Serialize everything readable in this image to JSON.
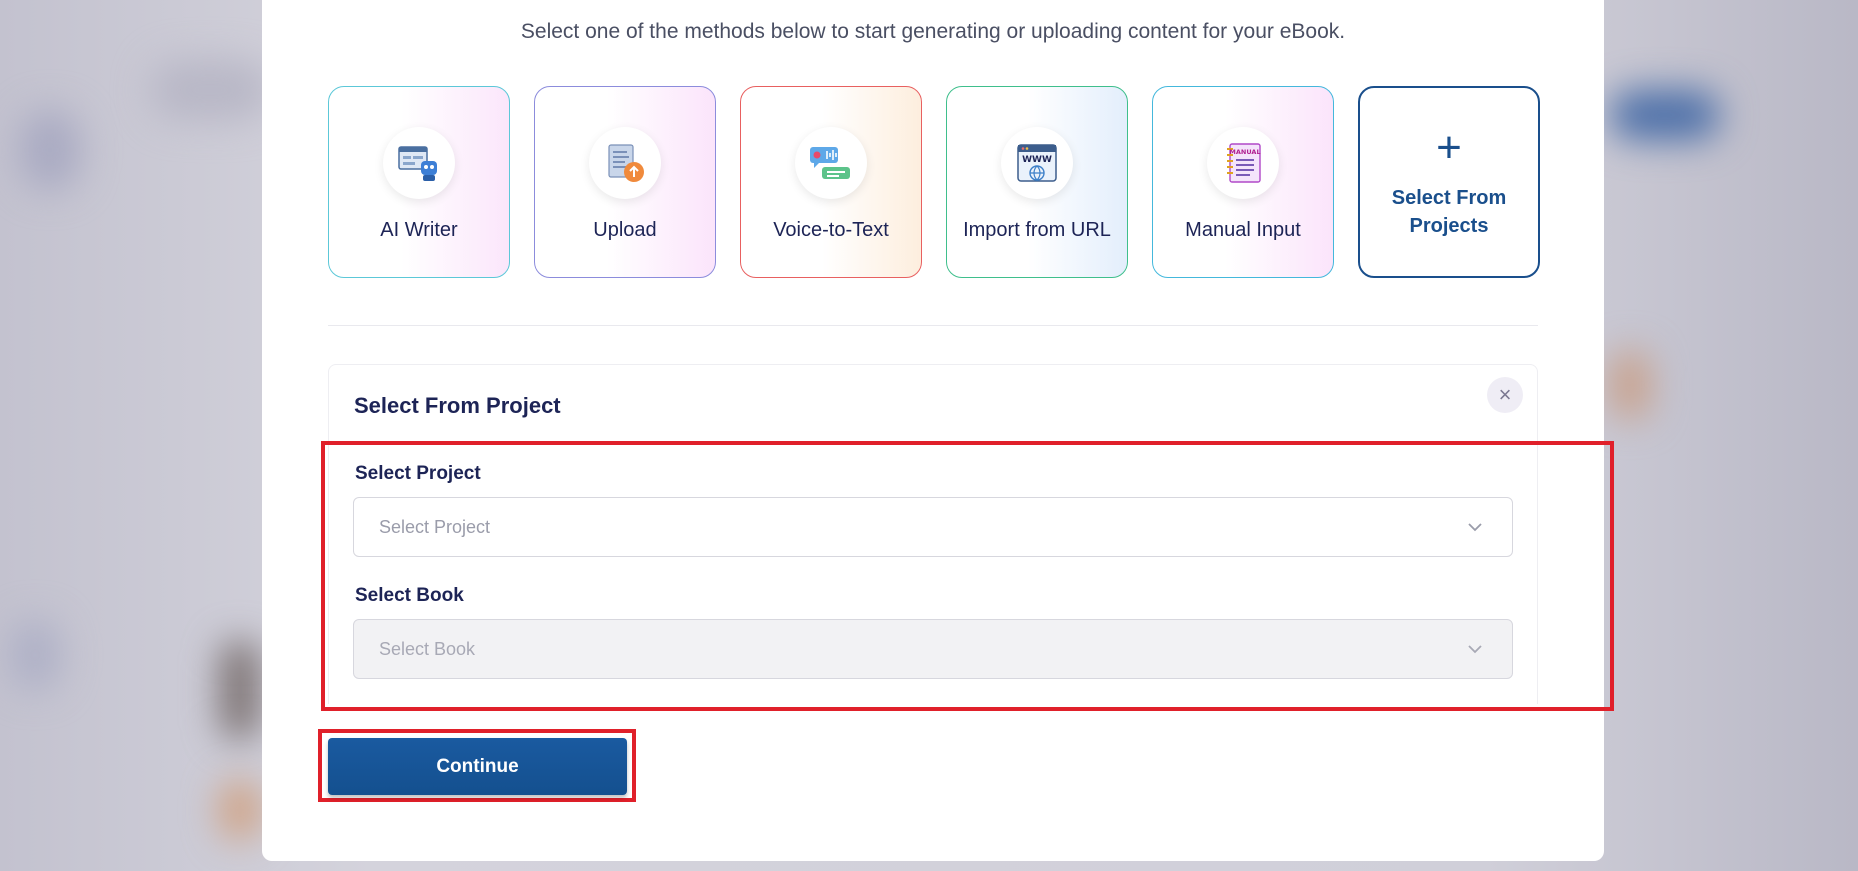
{
  "modal": {
    "subtitle": "Select one of the methods below to start generating or uploading content for your eBook."
  },
  "methods": [
    {
      "label": "AI Writer",
      "icon": "robot-writer-icon"
    },
    {
      "label": "Upload",
      "icon": "document-upload-icon"
    },
    {
      "label": "Voice-to-Text",
      "icon": "voice-chat-icon"
    },
    {
      "label": "Import from URL",
      "icon": "www-globe-icon"
    },
    {
      "label": "Manual Input",
      "icon": "manual-notebook-icon",
      "icon_text": "MANUAL"
    },
    {
      "label": "Select From Projects",
      "label_line1": "Select From",
      "label_line2": "Projects",
      "icon": "plus-icon",
      "selected": true
    }
  ],
  "panel": {
    "title": "Select From Project",
    "close_icon": "close-icon",
    "project_label": "Select Project",
    "project_placeholder": "Select Project",
    "book_label": "Select Book",
    "book_placeholder": "Select Book"
  },
  "continue_label": "Continue",
  "colors": {
    "accent": "#1a4f8c",
    "heading": "#1d2456",
    "highlight": "#e0202a"
  }
}
